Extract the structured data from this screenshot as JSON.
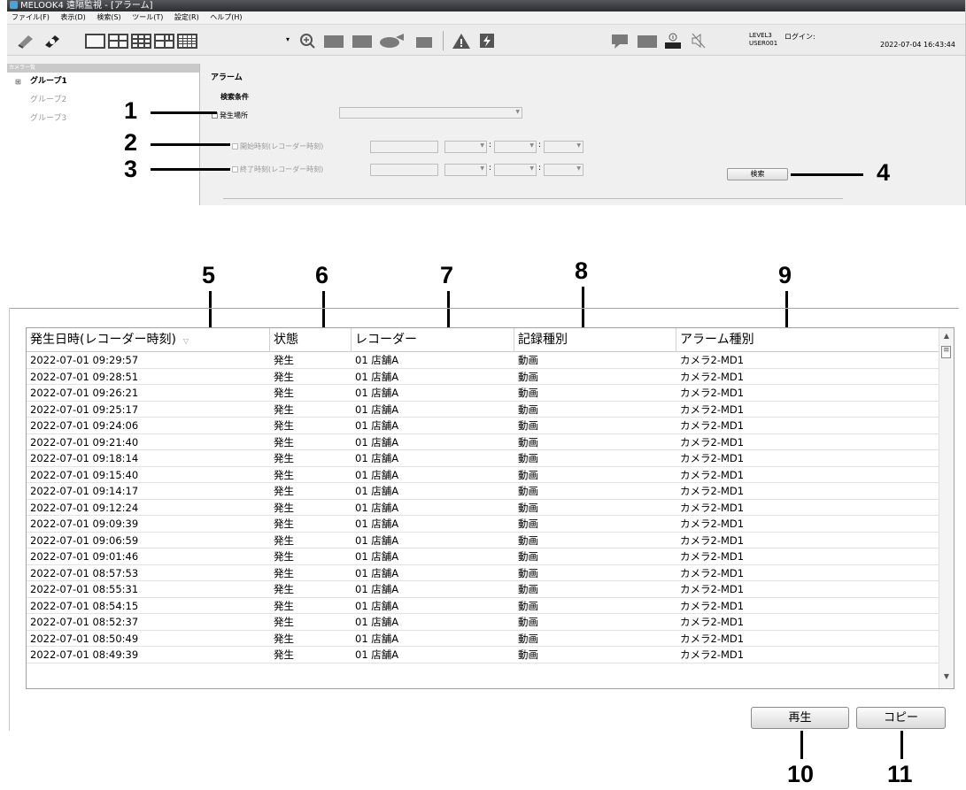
{
  "window": {
    "title": "MELOOK4 遠隔監視 - [アラーム]",
    "menu": [
      "ファイル(F)",
      "表示(D)",
      "検索(S)",
      "ツール(T)",
      "設定(R)",
      "ヘルプ(H)"
    ]
  },
  "status": {
    "level": "LEVEL3",
    "user": "USER001",
    "login_label": "ログイン:",
    "datetime": "2022-07-04 16:43:44"
  },
  "left_panel": {
    "header": "カメラ一覧",
    "groups": [
      "グループ1",
      "グループ2",
      "グループ3"
    ]
  },
  "alarm_panel": {
    "title": "アラーム",
    "search_conditions": "検索条件",
    "location_label": "発生場所",
    "start_time_label": "開始時刻(レコーダー時刻)",
    "end_time_label": "終了時刻(レコーダー時刻)",
    "search_button": "検索"
  },
  "callouts": [
    "1",
    "2",
    "3",
    "4",
    "5",
    "6",
    "7",
    "8",
    "9",
    "10",
    "11"
  ],
  "table": {
    "columns": [
      "発生日時(レコーダー時刻)",
      "状態",
      "レコーダー",
      "記録種別",
      "アラーム種別"
    ],
    "rows": [
      [
        "2022-07-01 09:29:57",
        "発生",
        "01 店舗A",
        "動画",
        "カメラ2-MD1"
      ],
      [
        "2022-07-01 09:28:51",
        "発生",
        "01 店舗A",
        "動画",
        "カメラ2-MD1"
      ],
      [
        "2022-07-01 09:26:21",
        "発生",
        "01 店舗A",
        "動画",
        "カメラ2-MD1"
      ],
      [
        "2022-07-01 09:25:17",
        "発生",
        "01 店舗A",
        "動画",
        "カメラ2-MD1"
      ],
      [
        "2022-07-01 09:24:06",
        "発生",
        "01 店舗A",
        "動画",
        "カメラ2-MD1"
      ],
      [
        "2022-07-01 09:21:40",
        "発生",
        "01 店舗A",
        "動画",
        "カメラ2-MD1"
      ],
      [
        "2022-07-01 09:18:14",
        "発生",
        "01 店舗A",
        "動画",
        "カメラ2-MD1"
      ],
      [
        "2022-07-01 09:15:40",
        "発生",
        "01 店舗A",
        "動画",
        "カメラ2-MD1"
      ],
      [
        "2022-07-01 09:14:17",
        "発生",
        "01 店舗A",
        "動画",
        "カメラ2-MD1"
      ],
      [
        "2022-07-01 09:12:24",
        "発生",
        "01 店舗A",
        "動画",
        "カメラ2-MD1"
      ],
      [
        "2022-07-01 09:09:39",
        "発生",
        "01 店舗A",
        "動画",
        "カメラ2-MD1"
      ],
      [
        "2022-07-01 09:06:59",
        "発生",
        "01 店舗A",
        "動画",
        "カメラ2-MD1"
      ],
      [
        "2022-07-01 09:01:46",
        "発生",
        "01 店舗A",
        "動画",
        "カメラ2-MD1"
      ],
      [
        "2022-07-01 08:57:53",
        "発生",
        "01 店舗A",
        "動画",
        "カメラ2-MD1"
      ],
      [
        "2022-07-01 08:55:31",
        "発生",
        "01 店舗A",
        "動画",
        "カメラ2-MD1"
      ],
      [
        "2022-07-01 08:54:15",
        "発生",
        "01 店舗A",
        "動画",
        "カメラ2-MD1"
      ],
      [
        "2022-07-01 08:52:37",
        "発生",
        "01 店舗A",
        "動画",
        "カメラ2-MD1"
      ],
      [
        "2022-07-01 08:50:49",
        "発生",
        "01 店舗A",
        "動画",
        "カメラ2-MD1"
      ],
      [
        "2022-07-01 08:49:39",
        "発生",
        "01 店舗A",
        "動画",
        "カメラ2-MD1"
      ]
    ]
  },
  "buttons": {
    "play": "再生",
    "copy": "コピー"
  }
}
